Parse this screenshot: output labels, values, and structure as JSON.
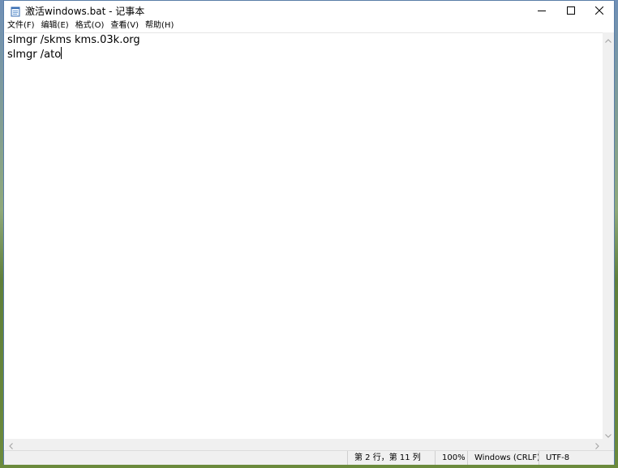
{
  "window": {
    "title": "激活windows.bat - 记事本"
  },
  "menu": {
    "items": [
      {
        "label": "文件(F)"
      },
      {
        "label": "编辑(E)"
      },
      {
        "label": "格式(O)"
      },
      {
        "label": "查看(V)"
      },
      {
        "label": "帮助(H)"
      }
    ]
  },
  "editor": {
    "lines": [
      "slmgr /skms kms.03k.org",
      "slmgr /ato"
    ]
  },
  "status": {
    "position": "第 2 行，第 11 列",
    "zoom": "100%",
    "line_ending": "Windows (CRLF)",
    "encoding": "UTF-8"
  },
  "colors": {
    "frame_border": "#5a7ea8",
    "statusbar_bg": "#f0f0f0"
  },
  "icons": {
    "app": "notepad-icon",
    "minimize": "minimize-icon",
    "maximize": "maximize-icon",
    "close": "close-icon"
  }
}
